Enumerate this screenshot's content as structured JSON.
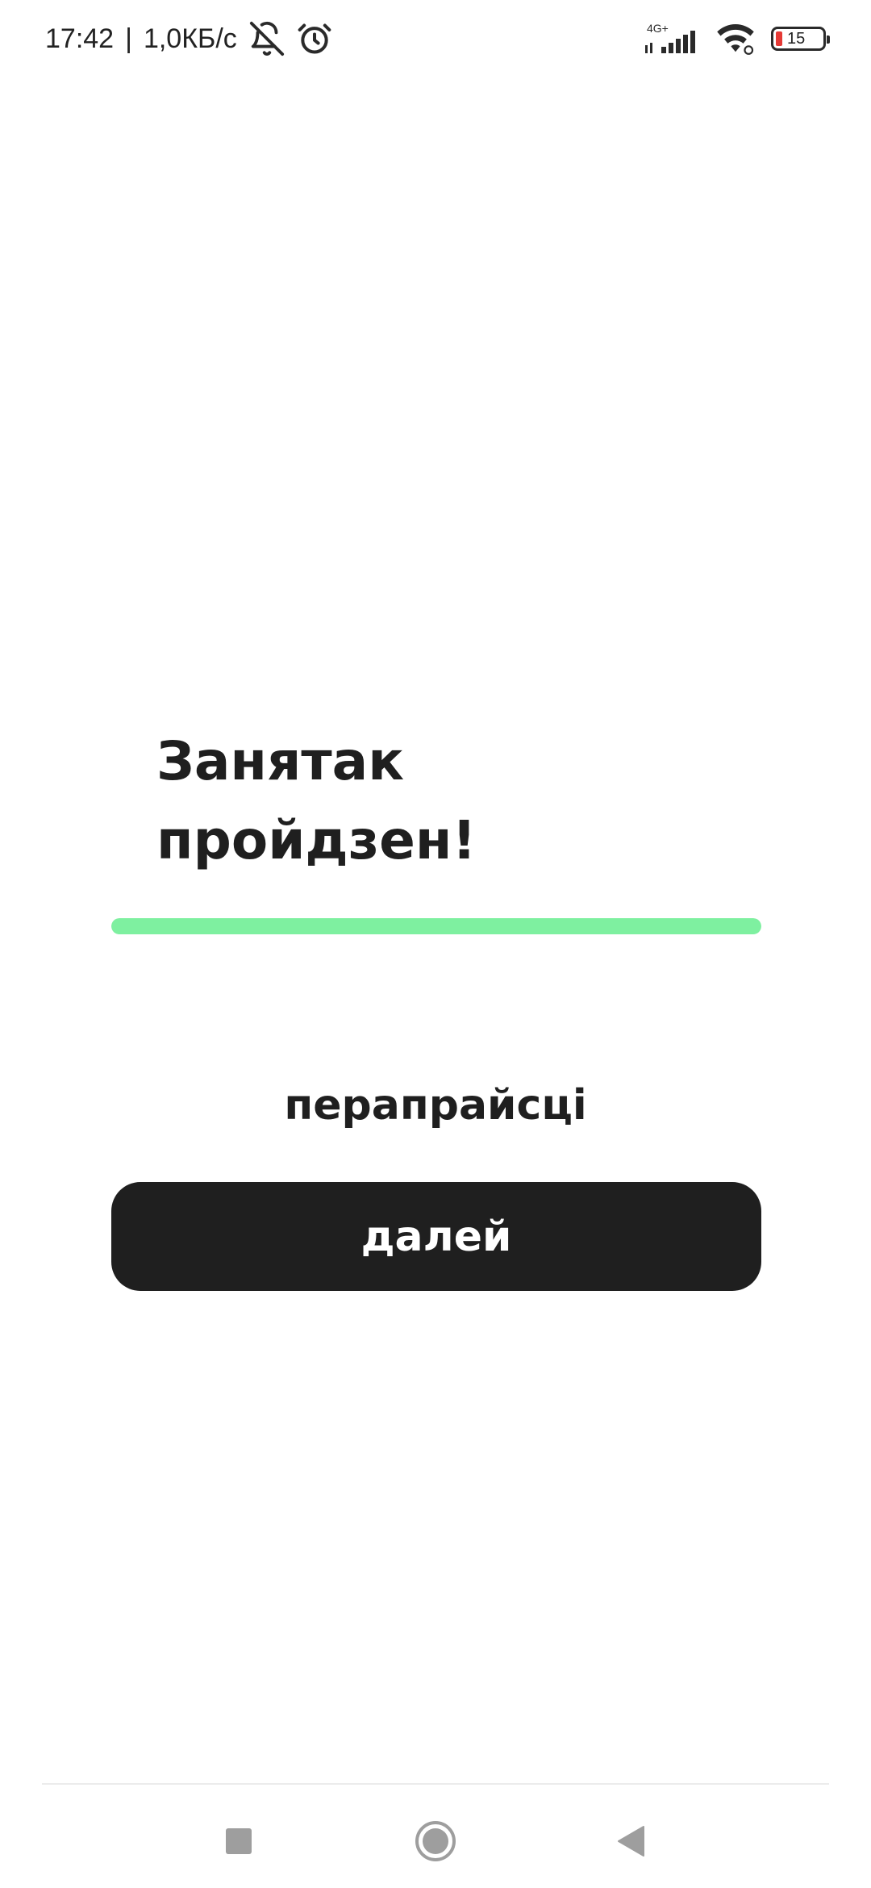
{
  "status_bar": {
    "time": "17:42",
    "separator": "|",
    "network_speed": "1,0КБ/с",
    "mute_icon": "bell-off-icon",
    "alarm_icon": "alarm-clock-icon",
    "mobile_network": "4G+",
    "signal_icon": "cell-signal-icon",
    "wifi_icon": "wifi-icon",
    "battery_level": "15",
    "battery_color": "#e53935"
  },
  "main": {
    "title": "Занятак\nпройдзен!",
    "progress": {
      "value": 1.0,
      "color": "#7ef0a0"
    },
    "repeat_label": "перапрайсці",
    "next_button_label": "далей",
    "button_color": "#1f1f1f"
  },
  "nav_bar": {
    "recents_icon": "square-recents-icon",
    "home_icon": "circle-home-icon",
    "back_icon": "triangle-back-icon"
  }
}
